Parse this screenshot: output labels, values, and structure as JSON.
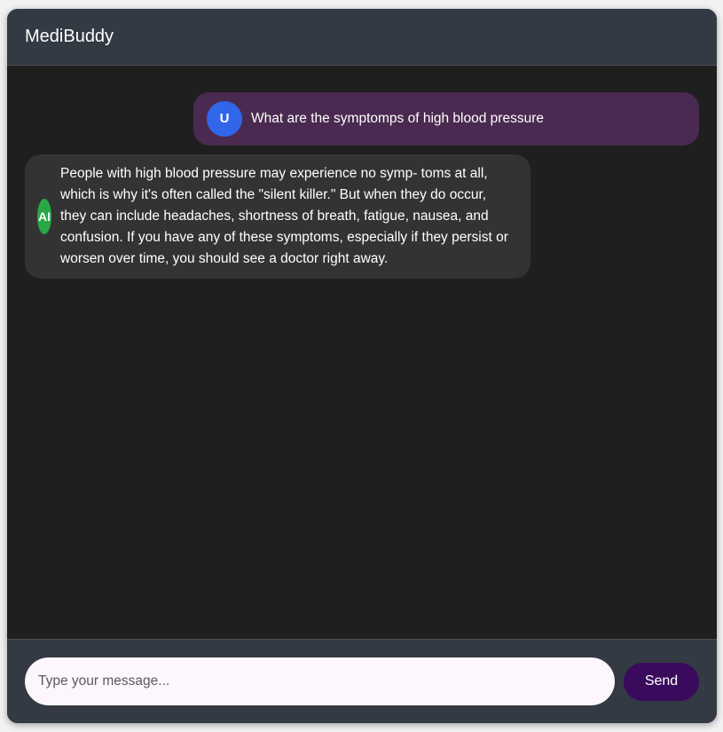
{
  "header": {
    "title": "MediBuddy"
  },
  "messages": [
    {
      "role": "user",
      "avatar": "U",
      "text": "What are the symptomps of high blood pressure"
    },
    {
      "role": "ai",
      "avatar": "AI",
      "text": "People with high blood pressure may experience no symp- toms at all, which is why it's often called the \"silent killer.\" But when they do occur, they can include headaches, shortness of breath, fatigue, nausea, and confusion. If you have any of these symptoms, especially if they persist or worsen over time, you should see a doctor right away."
    }
  ],
  "composer": {
    "placeholder": "Type your message...",
    "value": "",
    "send_label": "Send"
  },
  "colors": {
    "header_bg": "#343a43",
    "chat_bg": "#1f1f1f",
    "user_bubble": "#4a2a50",
    "ai_bubble": "#333333",
    "user_avatar": "#3166ea",
    "ai_avatar": "#28a745",
    "send_button": "#3a0a5c"
  }
}
